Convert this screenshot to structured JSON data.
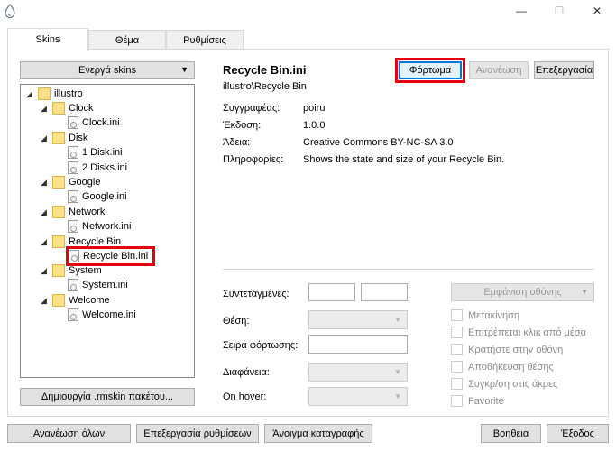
{
  "window": {
    "minimize_glyph": "—",
    "maximize_glyph": "☐",
    "close_glyph": "✕"
  },
  "tabs": [
    {
      "label": "Skins",
      "active": true
    },
    {
      "label": "Θέμα",
      "active": false
    },
    {
      "label": "Ρυθμίσεις",
      "active": false
    }
  ],
  "left": {
    "active_skins_label": "Ενεργά skins",
    "create_package_label": "Δημιουργία .rmskin πακέτου..."
  },
  "tree": {
    "root": "illustro",
    "items": [
      {
        "label": "Clock",
        "type": "folder"
      },
      {
        "label": "Clock.ini",
        "type": "file"
      },
      {
        "label": "Disk",
        "type": "folder"
      },
      {
        "label": "1 Disk.ini",
        "type": "file"
      },
      {
        "label": "2 Disks.ini",
        "type": "file"
      },
      {
        "label": "Google",
        "type": "folder"
      },
      {
        "label": "Google.ini",
        "type": "file"
      },
      {
        "label": "Network",
        "type": "folder"
      },
      {
        "label": "Network.ini",
        "type": "file"
      },
      {
        "label": "Recycle Bin",
        "type": "folder"
      },
      {
        "label": "Recycle Bin.ini",
        "type": "file",
        "selected": true
      },
      {
        "label": "System",
        "type": "folder"
      },
      {
        "label": "System.ini",
        "type": "file"
      },
      {
        "label": "Welcome",
        "type": "folder"
      },
      {
        "label": "Welcome.ini",
        "type": "file"
      }
    ]
  },
  "skin": {
    "title": "Recycle Bin.ini",
    "path": "illustro\\Recycle Bin",
    "author_label": "Συγγραφέας:",
    "author": "poiru",
    "version_label": "Έκδοση:",
    "version": "1.0.0",
    "license_label": "Άδεια:",
    "license": "Creative Commons BY-NC-SA 3.0",
    "info_label": "Πληροφορίες:",
    "info": "Shows the state and size of your Recycle Bin."
  },
  "actions": {
    "load": "Φόρτωμα",
    "refresh": "Ανανέωση",
    "edit": "Επεξεργασία"
  },
  "settings": {
    "coordinates_label": "Συντεταγμένες:",
    "display_monitor": "Εμφάνιση οθόνης",
    "position_label": "Θέση:",
    "load_order_label": "Σειρά φόρτωσης:",
    "transparency_label": "Διαφάνεια:",
    "on_hover_label": "On hover:",
    "checkboxes": [
      "Μετακίνηση",
      "Επιτρέπεται κλικ από μέσα",
      "Κρατήστε στην οθόνη",
      "Αποθήκευση θέσης",
      "Συγκρ/ση στις άκρες",
      "Favorite"
    ]
  },
  "footer": {
    "refresh_all": "Ανανέωση όλων",
    "edit_settings": "Επεξεργασία ρυθμίσεων",
    "open_log": "Άνοιγμα καταγραφής",
    "help": "Βοηθεια",
    "exit": "Έξοδος"
  },
  "colors": {
    "highlight": "#e4000f",
    "focus": "#0078d7",
    "folder": "#ffe288"
  }
}
